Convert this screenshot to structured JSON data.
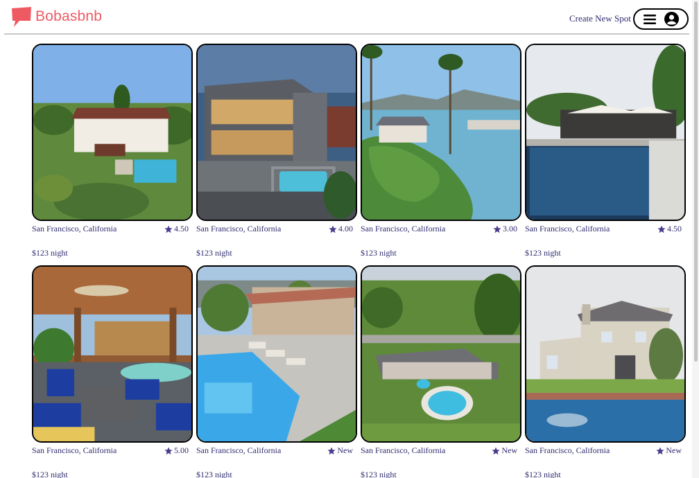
{
  "header": {
    "brand": "Bobasbnb",
    "create_spot": "Create New Spot",
    "brand_color": "#ee5a62",
    "text_color": "#2f2b6e"
  },
  "icons": {
    "logo": "speech-bubble-logo-icon",
    "menu": "hamburger-menu-icon",
    "profile": "user-circle-icon",
    "rating": "star-icon"
  },
  "spots": [
    {
      "location": "San Francisco, California",
      "rating": "4.50",
      "price": "$123 night",
      "scene": "estate-with-pool"
    },
    {
      "location": "San Francisco, California",
      "rating": "4.00",
      "price": "$123 night",
      "scene": "modern-house-hot-tub-dusk"
    },
    {
      "location": "San Francisco, California",
      "rating": "3.00",
      "price": "$123 night",
      "scene": "waterfront-palm-island"
    },
    {
      "location": "San Francisco, California",
      "rating": "4.50",
      "price": "$123 night",
      "scene": "infinity-pool-patio"
    },
    {
      "location": "San Francisco, California",
      "rating": "5.00",
      "price": "$123 night",
      "scene": "covered-patio-pool"
    },
    {
      "location": "San Francisco, California",
      "rating": "New",
      "price": "$123 night",
      "scene": "pool-with-loungers"
    },
    {
      "location": "San Francisco, California",
      "rating": "New",
      "price": "$123 night",
      "scene": "aerial-ranch-oval-pool"
    },
    {
      "location": "San Francisco, California",
      "rating": "New",
      "price": "$123 night",
      "scene": "house-with-pond"
    }
  ]
}
